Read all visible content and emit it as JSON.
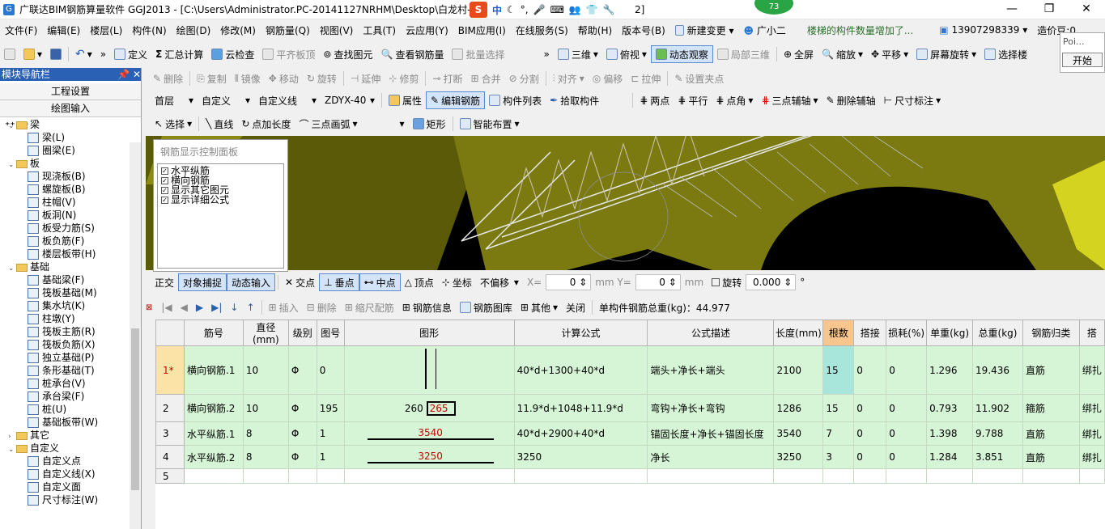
{
  "title": {
    "text": "广联达BIM钢筋算量软件 GGJ2013 - [C:\\Users\\Administrator.PC-20141127NRHM\\Desktop\\白龙村-",
    "tail": "2]",
    "badge": "73",
    "ime": [
      "S",
      "中"
    ]
  },
  "menu": {
    "items": [
      "文件(F)",
      "编辑(E)",
      "楼层(L)",
      "构件(N)",
      "绘图(D)",
      "修改(M)",
      "钢筋量(Q)",
      "视图(V)",
      "工具(T)",
      "云应用(Y)",
      "BIM应用(I)",
      "在线服务(S)",
      "帮助(H)",
      "版本号(B)",
      "新建变更",
      "广小二"
    ],
    "message": "楼梯的构件数量增加了...",
    "phone": "13907298339",
    "price": "造价豆:0",
    "popup_label": "Poi...",
    "start_label": "开始"
  },
  "toolbar1": {
    "define": "定义",
    "sum": "汇总计算",
    "cloud_check": "云检查",
    "align_top": "平齐板顶",
    "find": "查找图元",
    "view_rebar": "查看钢筋量",
    "batch": "批量选择",
    "view3d": "三维",
    "plan": "俯视",
    "dynamic": "动态观察",
    "local3d": "局部三维",
    "fullscreen": "全屏",
    "zoom": "缩放",
    "pan": "平移",
    "rotate": "屏幕旋转",
    "select_floor": "选择楼"
  },
  "toolbar2": {
    "delete": "删除",
    "copy": "复制",
    "mirror": "镜像",
    "move": "移动",
    "rotate": "旋转",
    "extend": "延伸",
    "trim": "修剪",
    "break": "打断",
    "merge": "合并",
    "split": "分割",
    "align": "对齐",
    "offset": "偏移",
    "stretch": "拉伸",
    "set_point": "设置夹点"
  },
  "toolbar3": {
    "floor": "首层",
    "category": "自定义",
    "type": "自定义线",
    "element": "ZDYX-40",
    "attr": "属性",
    "edit_rebar": "编辑钢筋",
    "list": "构件列表",
    "pick": "拾取构件",
    "two_point": "两点",
    "parallel": "平行",
    "point_angle": "点角",
    "three_axis": "三点辅轴",
    "del_axis": "删除辅轴",
    "dim": "尺寸标注"
  },
  "toolbar4": {
    "select": "选择",
    "line": "直线",
    "point_len": "点加长度",
    "arc": "三点画弧",
    "rect": "矩形",
    "smart": "智能布置"
  },
  "nav": {
    "header": "模块导航栏",
    "project_settings": "工程设置",
    "drawing_input": "绘图输入",
    "tree": [
      {
        "level": 0,
        "label": "梁",
        "folder": true
      },
      {
        "level": 1,
        "label": "梁(L)"
      },
      {
        "level": 1,
        "label": "圈梁(E)"
      },
      {
        "level": 0,
        "label": "板",
        "folder": true
      },
      {
        "level": 1,
        "label": "现浇板(B)"
      },
      {
        "level": 1,
        "label": "螺旋板(B)"
      },
      {
        "level": 1,
        "label": "柱帽(V)"
      },
      {
        "level": 1,
        "label": "板洞(N)"
      },
      {
        "level": 1,
        "label": "板受力筋(S)"
      },
      {
        "level": 1,
        "label": "板负筋(F)"
      },
      {
        "level": 1,
        "label": "楼层板带(H)"
      },
      {
        "level": 0,
        "label": "基础",
        "folder": true
      },
      {
        "level": 1,
        "label": "基础梁(F)"
      },
      {
        "level": 1,
        "label": "筏板基础(M)"
      },
      {
        "level": 1,
        "label": "集水坑(K)"
      },
      {
        "level": 1,
        "label": "柱墩(Y)"
      },
      {
        "level": 1,
        "label": "筏板主筋(R)"
      },
      {
        "level": 1,
        "label": "筏板负筋(X)"
      },
      {
        "level": 1,
        "label": "独立基础(P)"
      },
      {
        "level": 1,
        "label": "条形基础(T)"
      },
      {
        "level": 1,
        "label": "桩承台(V)"
      },
      {
        "level": 1,
        "label": "承台梁(F)"
      },
      {
        "level": 1,
        "label": "桩(U)"
      },
      {
        "level": 1,
        "label": "基础板带(W)"
      },
      {
        "level": 0,
        "label": "其它",
        "folder": true,
        "collapsed": true
      },
      {
        "level": 0,
        "label": "自定义",
        "folder": true
      },
      {
        "level": 1,
        "label": "自定义点"
      },
      {
        "level": 1,
        "label": "自定义线(X)"
      },
      {
        "level": 1,
        "label": "自定义面"
      },
      {
        "level": 1,
        "label": "尺寸标注(W)"
      }
    ]
  },
  "control_panel": {
    "title": "钢筋显示控制面板",
    "items": [
      "水平纵筋",
      "横向钢筋",
      "显示其它图元",
      "显示详细公式"
    ]
  },
  "snap_bar": {
    "ortho": "正交",
    "snap": "对象捕捉",
    "dyn_input": "动态输入",
    "intersect": "交点",
    "perp": "垂点",
    "mid": "中点",
    "vertex": "顶点",
    "coord": "坐标",
    "offset_mode": "不偏移",
    "x_label": "X=",
    "x_val": "0",
    "y_label": "mm Y=",
    "y_val": "0",
    "mm": "mm",
    "rotate": "旋转",
    "angle": "0.000",
    "deg": "°"
  },
  "grid_toolbar": {
    "insert": "插入",
    "delete": "删除",
    "scale": "缩尺配筋",
    "info": "钢筋信息",
    "lib": "钢筋图库",
    "other": "其他",
    "close": "关闭",
    "total": "单构件钢筋总重(kg)：44.977"
  },
  "grid": {
    "headers": [
      "",
      "筋号",
      "直径(mm)",
      "级别",
      "图号",
      "图形",
      "计算公式",
      "公式描述",
      "长度(mm)",
      "根数",
      "搭接",
      "损耗(%)",
      "单重(kg)",
      "总重(kg)",
      "钢筋归类",
      "搭"
    ],
    "rows": [
      {
        "rh": "1*",
        "name": "横向钢筋.1",
        "dia": "10",
        "grade": "Φ",
        "fig": "0",
        "shape_num": "",
        "formula": "40*d+1300+40*d",
        "desc": "端头+净长+端头",
        "len": "2100",
        "count": "15",
        "lap": "0",
        "loss": "0",
        "unit": "1.296",
        "total": "19.436",
        "cat": "直筋",
        "tie": "绑扎"
      },
      {
        "rh": "2",
        "name": "横向钢筋.2",
        "dia": "10",
        "grade": "Φ",
        "fig": "195",
        "shape_num": "260",
        "shape_red": "265",
        "formula": "11.9*d+1048+11.9*d",
        "desc": "弯钩+净长+弯钩",
        "len": "1286",
        "count": "15",
        "lap": "0",
        "loss": "0",
        "unit": "0.793",
        "total": "11.902",
        "cat": "箍筋",
        "tie": "绑扎"
      },
      {
        "rh": "3",
        "name": "水平纵筋.1",
        "dia": "8",
        "grade": "Φ",
        "fig": "1",
        "shape_red": "3540",
        "formula": "40*d+2900+40*d",
        "desc": "锚固长度+净长+锚固长度",
        "len": "3540",
        "count": "7",
        "lap": "0",
        "loss": "0",
        "unit": "1.398",
        "total": "9.788",
        "cat": "直筋",
        "tie": "绑扎"
      },
      {
        "rh": "4",
        "name": "水平纵筋.2",
        "dia": "8",
        "grade": "Φ",
        "fig": "1",
        "shape_red": "3250",
        "formula": "3250",
        "desc": "净长",
        "len": "3250",
        "count": "3",
        "lap": "0",
        "loss": "0",
        "unit": "1.284",
        "total": "3.851",
        "cat": "直筋",
        "tie": "绑扎"
      },
      {
        "rh": "5"
      }
    ]
  }
}
